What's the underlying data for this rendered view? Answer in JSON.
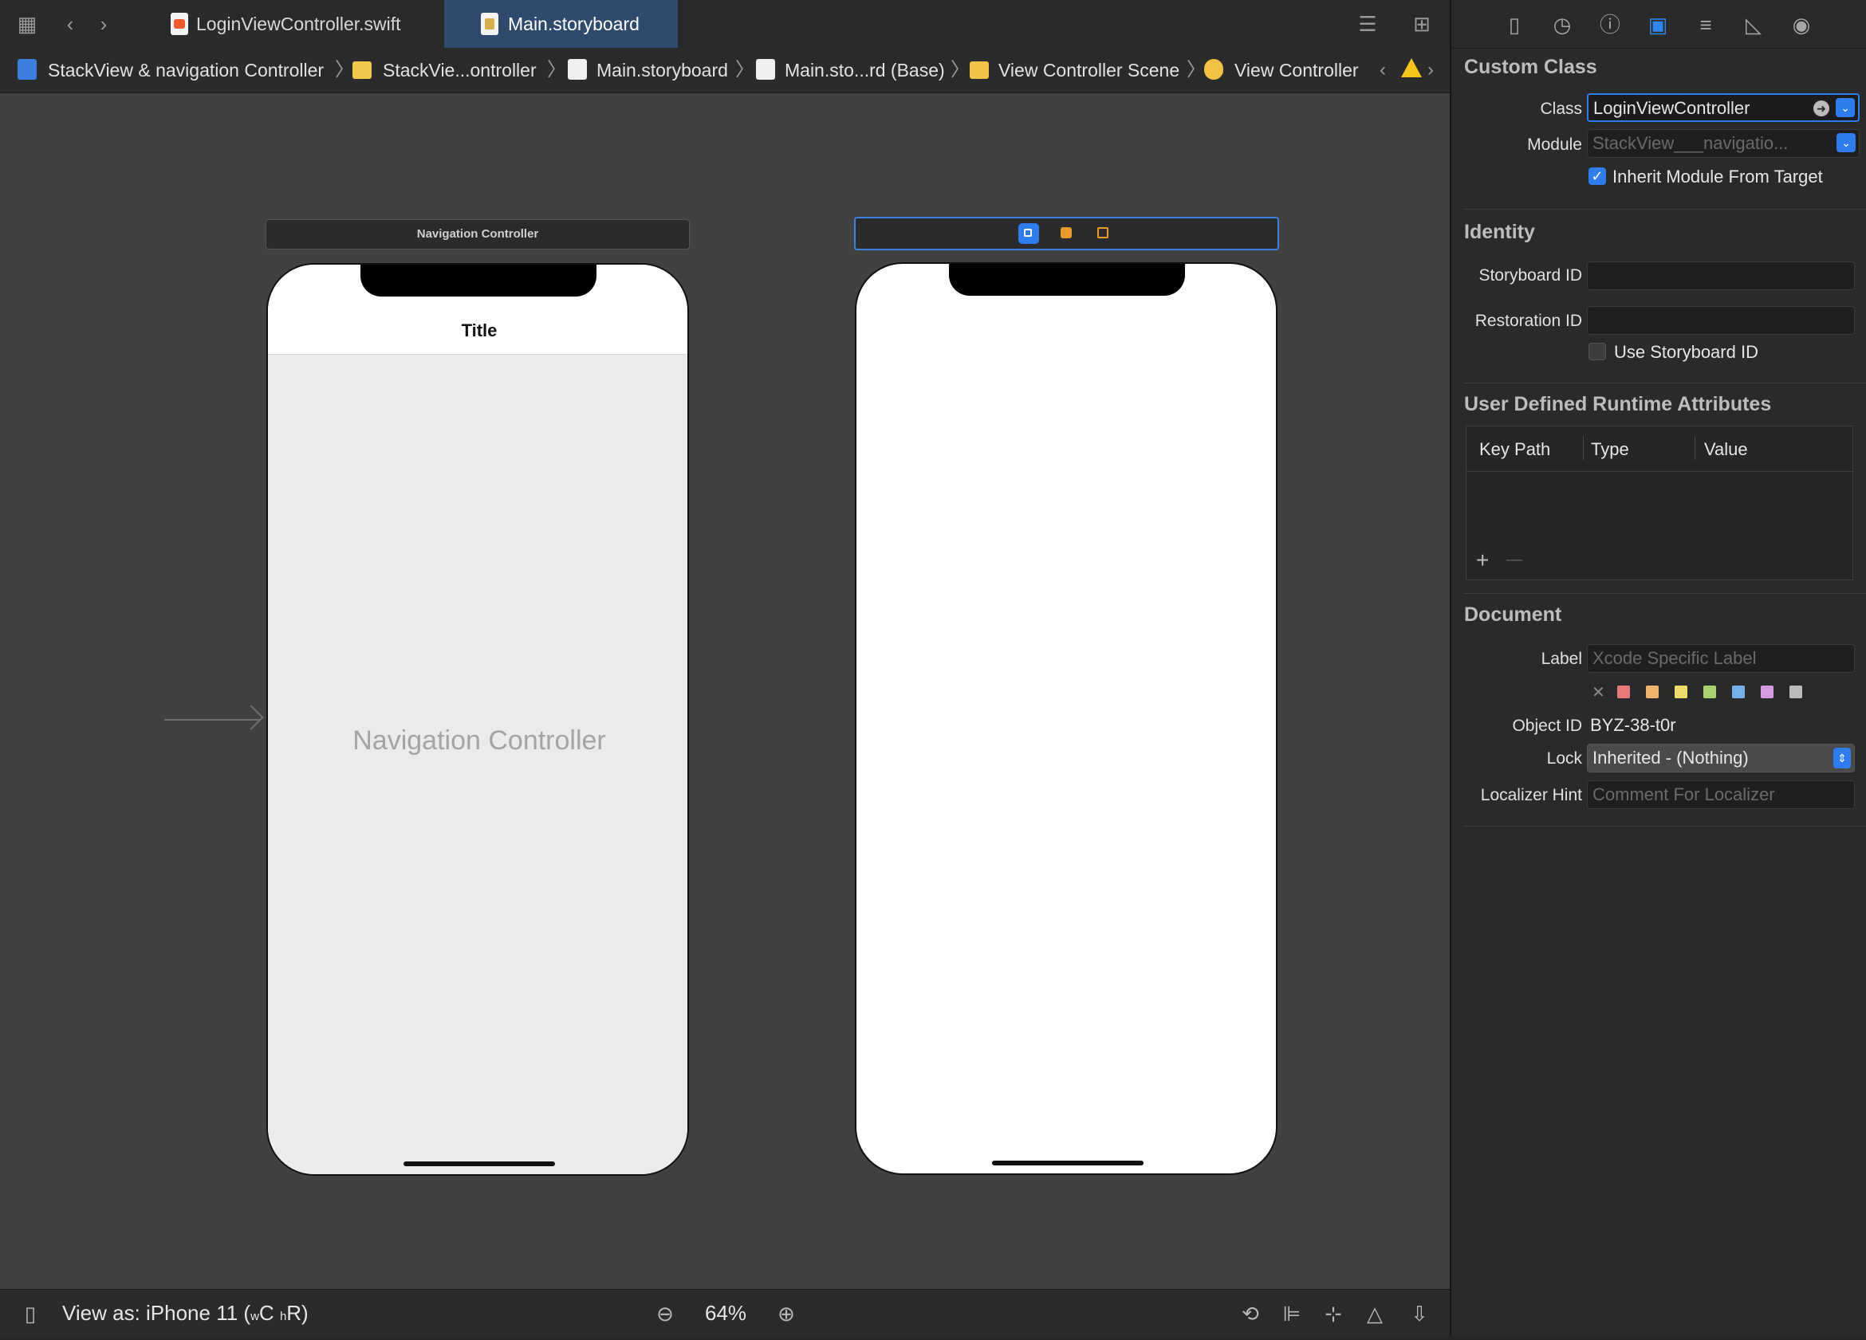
{
  "tabs": [
    {
      "label": "LoginViewController.swift",
      "active": false
    },
    {
      "label": "Main.storyboard",
      "active": true
    }
  ],
  "breadcrumb": [
    "StackView & navigation Controller",
    "StackVie...ontroller",
    "Main.storyboard",
    "Main.sto...rd (Base)",
    "View Controller Scene",
    "View Controller"
  ],
  "canvas": {
    "nav_scene_title": "Navigation Controller",
    "nav_bar_title": "Title",
    "nav_placeholder": "Navigation Controller"
  },
  "statusbar": {
    "view_as_prefix": "View as: iPhone 11 (",
    "w_small": "w",
    "w_big": "C",
    "h_small": "h",
    "h_big": "R)",
    "zoom": "64%"
  },
  "inspector": {
    "custom_class": {
      "title": "Custom Class",
      "class_label": "Class",
      "class_value": "LoginViewController",
      "module_label": "Module",
      "module_placeholder": "StackView___navigatio...",
      "inherit_label": "Inherit Module From Target",
      "inherit_checked": true
    },
    "identity": {
      "title": "Identity",
      "storyboard_id_label": "Storyboard ID",
      "storyboard_id_value": "",
      "restoration_id_label": "Restoration ID",
      "restoration_id_value": "",
      "use_storyboard_id_label": "Use Storyboard ID",
      "use_storyboard_id_checked": false
    },
    "runtime_attributes": {
      "title": "User Defined Runtime Attributes",
      "columns": [
        "Key Path",
        "Type",
        "Value"
      ],
      "add_label": "+",
      "remove_label": "—"
    },
    "document": {
      "title": "Document",
      "label_label": "Label",
      "label_placeholder": "Xcode Specific Label",
      "clear_label": "✕",
      "label_colors": [
        "#e87a7a",
        "#f2b36b",
        "#eedc6a",
        "#a9d26e",
        "#74b1ea",
        "#d49ae0",
        "#bcbcbc"
      ],
      "object_id_label": "Object ID",
      "object_id_value": "BYZ-38-t0r",
      "lock_label": "Lock",
      "lock_value": "Inherited - (Nothing)",
      "localizer_hint_label": "Localizer Hint",
      "localizer_hint_placeholder": "Comment For Localizer"
    }
  },
  "colors": {
    "accent": "#2f7cf0",
    "active_tab": "#2e4b6e",
    "warning": "#f5c518"
  }
}
